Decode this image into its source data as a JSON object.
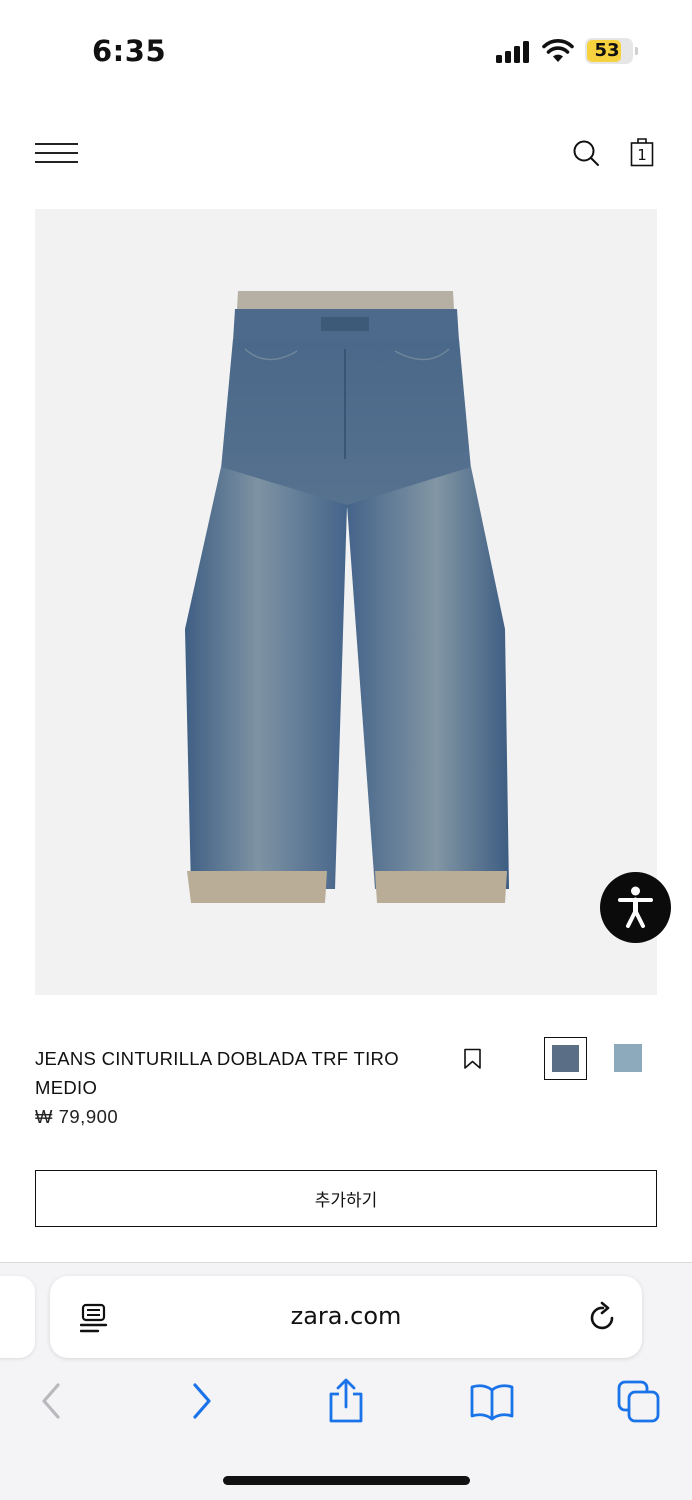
{
  "status_bar": {
    "time": "6:35",
    "battery_level": "53",
    "icons": [
      "cellular-signal-icon",
      "wifi-icon",
      "battery-icon"
    ]
  },
  "header": {
    "cart_count": "1",
    "icons": [
      "hamburger-menu-icon",
      "search-icon",
      "shopping-bag-icon"
    ]
  },
  "product": {
    "image_subject": "jeans",
    "name": "JEANS CINTURILLA DOBLADA TRF TIRO MEDIO",
    "price": "₩ 79,900",
    "colors": [
      {
        "hex": "#5a6f86",
        "selected": true
      },
      {
        "hex": "#8daabd",
        "selected": false
      }
    ],
    "add_button_label": "추가하기"
  },
  "browser": {
    "url": "zara.com",
    "icons": [
      "reader-mode-icon",
      "reload-icon",
      "back-icon",
      "forward-icon",
      "share-icon",
      "bookmarks-icon",
      "tabs-icon"
    ],
    "accent": "#1a73e8"
  },
  "colors": {
    "image_background": "#f2f2f2",
    "battery": "#f7d23f",
    "toolbar_background": "#f4f4f6"
  }
}
